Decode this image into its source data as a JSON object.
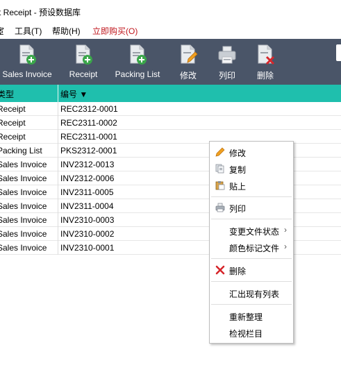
{
  "window": {
    "title": "t Receipt - 预设数据库"
  },
  "menu": {
    "items": [
      {
        "label": "宦"
      },
      {
        "label": "工具(T)"
      },
      {
        "label": "帮助(H)"
      },
      {
        "label": "立即购买(O)"
      }
    ]
  },
  "toolbar": {
    "buttons": [
      {
        "label": "Sales Invoice",
        "icon": "doc-add-icon"
      },
      {
        "label": "Receipt",
        "icon": "doc-add-icon"
      },
      {
        "label": "Packing List",
        "icon": "doc-add-icon"
      },
      {
        "label": "修改",
        "icon": "edit-icon"
      },
      {
        "label": "列印",
        "icon": "printer-icon"
      },
      {
        "label": "删除",
        "icon": "delete-doc-icon"
      }
    ]
  },
  "grid": {
    "columns": [
      {
        "label": "类型"
      },
      {
        "label": "编号 ▼"
      }
    ],
    "rows": [
      {
        "type": "Receipt",
        "number": "REC2312-0001"
      },
      {
        "type": "Receipt",
        "number": "REC2311-0002"
      },
      {
        "type": "Receipt",
        "number": "REC2311-0001"
      },
      {
        "type": "Packing List",
        "number": "PKS2312-0001"
      },
      {
        "type": "Sales Invoice",
        "number": "INV2312-0013"
      },
      {
        "type": "Sales Invoice",
        "number": "INV2312-0006"
      },
      {
        "type": "Sales Invoice",
        "number": "INV2311-0005"
      },
      {
        "type": "Sales Invoice",
        "number": "INV2311-0004"
      },
      {
        "type": "Sales Invoice",
        "number": "INV2310-0003"
      },
      {
        "type": "Sales Invoice",
        "number": "INV2310-0002"
      },
      {
        "type": "Sales Invoice",
        "number": "INV2310-0001"
      }
    ]
  },
  "context_menu": {
    "items": [
      {
        "label": "修改",
        "icon": "pencil-icon"
      },
      {
        "label": "复制",
        "icon": "copy-icon"
      },
      {
        "label": "贴上",
        "icon": "paste-icon"
      },
      {
        "label": "列印",
        "icon": "printer-icon"
      },
      {
        "label": "变更文件状态",
        "submenu": true
      },
      {
        "label": "颜色标记文件",
        "submenu": true
      },
      {
        "label": "删除",
        "icon": "delete-x-icon"
      },
      {
        "label": "汇出现有列表"
      },
      {
        "label": "重新整理"
      },
      {
        "label": "检视栏目"
      }
    ],
    "submenu_arrow": "›"
  },
  "colors": {
    "toolbar_bg": "#4a5568",
    "header_bg": "#1fbfad",
    "buy_text": "#c0161d",
    "add_badge": "#3aa64a",
    "delete_red": "#d6262b",
    "pencil_orange": "#f0a020"
  }
}
